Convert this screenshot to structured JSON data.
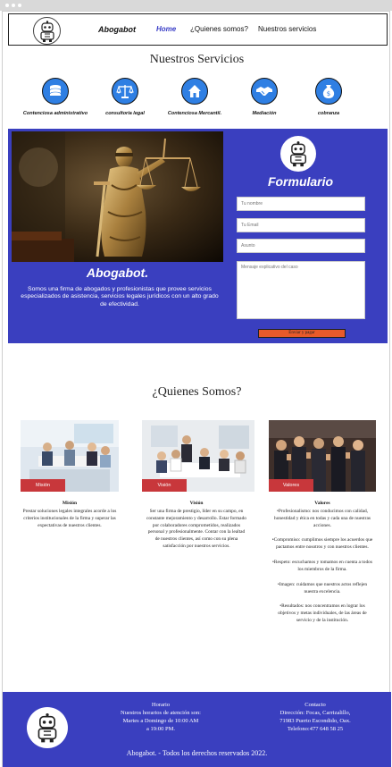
{
  "nav": {
    "brand": "Abogabot",
    "links": [
      "Home",
      "¿Quienes somos?",
      "Nuestros servicios"
    ]
  },
  "services": {
    "title": "Nuestros Servicios",
    "items": [
      {
        "label": "Contenciosa administrativo",
        "icon": "coins-icon"
      },
      {
        "label": "consultoria legal",
        "icon": "scales-icon"
      },
      {
        "label": "Contenciosa Mercantil.",
        "icon": "house-icon"
      },
      {
        "label": "Mediación",
        "icon": "handshake-icon"
      },
      {
        "label": "cobranza",
        "icon": "money-bag-icon"
      }
    ]
  },
  "hero": {
    "title": "Abogabot.",
    "description": "Somos una firma de abogados y profesionistas que provee servicios especializados de asistencia, servicios legales jurídicos con un alto  grado de efectividad."
  },
  "form": {
    "title": "Formulario",
    "name_placeholder": "Tu nombre",
    "email_placeholder": "Tu Email",
    "subject_placeholder": "Asunto",
    "message_placeholder": "Mensaje explicativo del caso",
    "submit_label": "Enviar y pagar"
  },
  "about": {
    "title": "¿Quienes Somos?",
    "cards": [
      {
        "tag": "Misión",
        "heading": "Misión",
        "text": "Prestar soluciones legales integrales acorde a los  criterios institucionales de la firma y superar las expectativas de  nuestros clientes."
      },
      {
        "tag": "Visión",
        "heading": "Visión",
        "text": "Ser una firma de prestigio, líder en su campo, en constante mejoramiento y desarrollo. Estar formado por colaboradores  comprometidos, realizados personal y profesionalmente. Contar con la  lealtad de nuestros clientes, así como con su plena satisfacción por  nuestros servicios."
      },
      {
        "tag": "Valores",
        "heading": "Valores",
        "values": [
          "•Profesionalismo: nos conducimos con calidad, honestidad y ética en todas y cada una de nuestras acciones.",
          "•Compromiso: cumplimos siempre los acuerdos que pactamos entre nosotros y con nuestros clientes.",
          "•Respeto: escuchamos y tomamos en cuenta a todos los miembros de la firma.",
          "•Imagen: cuidamos que nuestros actos reflejen nuestra excelencia.",
          "•Resultados: nos concentramos en lograr los objetivos y metas individuales, de las áreas de servicio y de la institución."
        ]
      }
    ]
  },
  "footer": {
    "hours_title": "Horario",
    "hours_line1": "Nuestros horarios de atención son:",
    "hours_line2": "Martes a Domingo de 10:00 AM",
    "hours_line3": "a 19:00 PM.",
    "contact_title": "Contacto",
    "contact_line1": "Dirección: Focas, Carrizalillo,",
    "contact_line2": "71983 Puerto Escondido, Oax.",
    "contact_line3": "Telefono:477 648 58 25",
    "copyright": "Abogabot.  - Todos los derechos reservados 2022."
  },
  "colors": {
    "accent": "#3a3fbf",
    "icon_blue": "#2f7fe3",
    "tag_red": "#c8373b",
    "button_orange": "#e85a2a"
  }
}
